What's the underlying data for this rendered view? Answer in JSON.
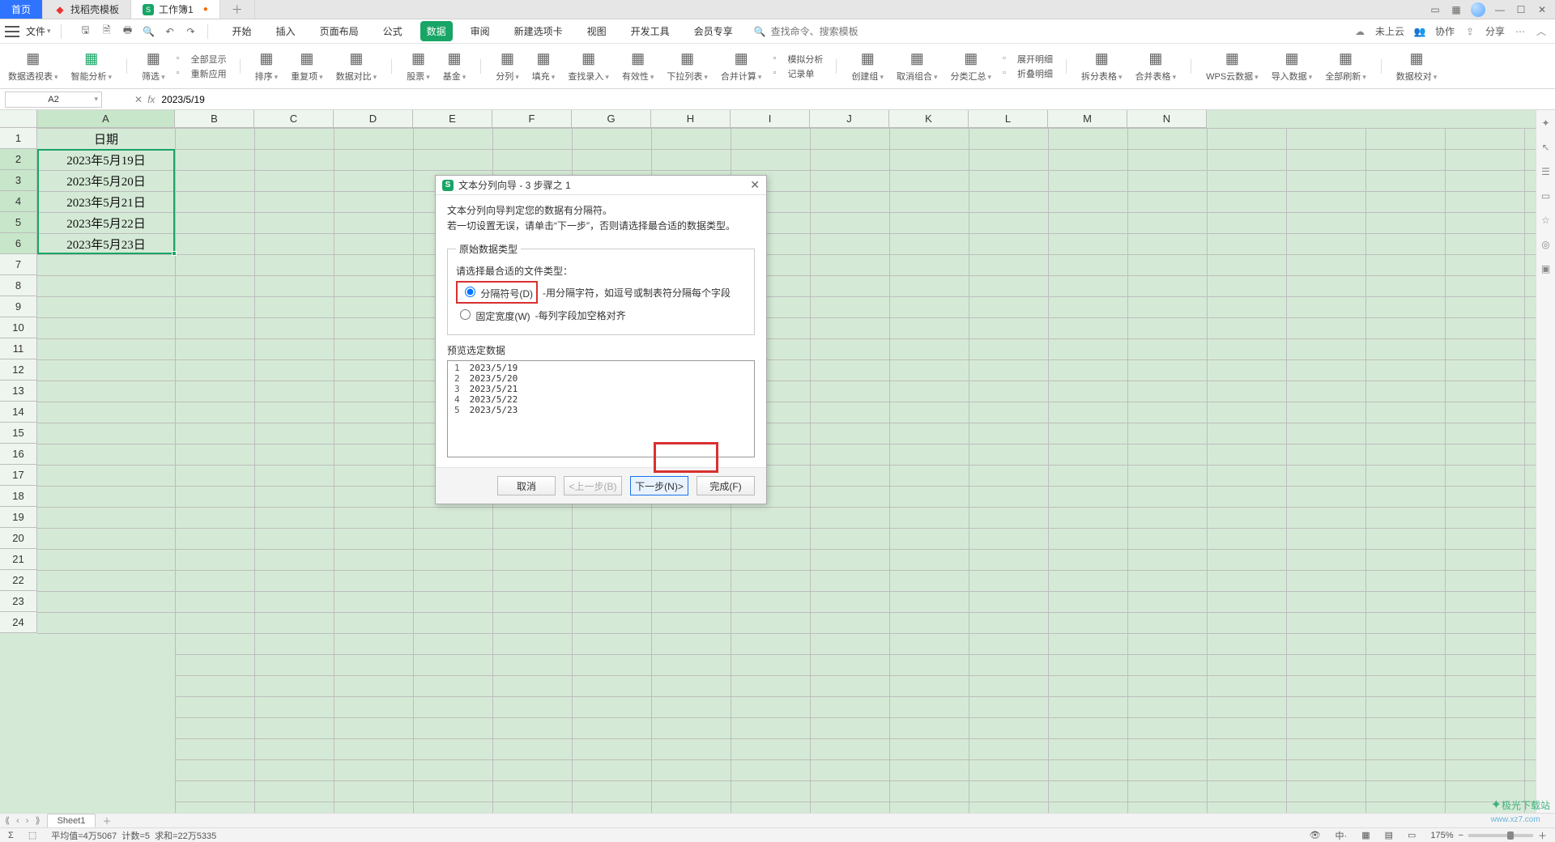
{
  "tabs": {
    "home": "首页",
    "template_title": "找稻壳模板",
    "workbook_title": "工作簿1"
  },
  "file_menu": "文件",
  "ribbon_tabs": [
    "开始",
    "插入",
    "页面布局",
    "公式",
    "数据",
    "审阅",
    "新建选项卡",
    "视图",
    "开发工具",
    "会员专享"
  ],
  "ribbon_active_index": 4,
  "search_placeholder": "查找命令、搜索模板",
  "right_menu": {
    "cloud": "未上云",
    "coop": "协作",
    "share": "分享"
  },
  "ribbon_cols": [
    {
      "label": "数据透视表"
    },
    {
      "label": "智能分析",
      "green": true
    },
    {
      "label": "筛选"
    },
    {
      "labels": [
        "全部显示",
        "重新应用"
      ]
    },
    {
      "label": "排序"
    },
    {
      "label": "重复项"
    },
    {
      "label": "数据对比"
    },
    {
      "label": "股票"
    },
    {
      "label": "基金"
    },
    {
      "label": "分列"
    },
    {
      "label": "填充"
    },
    {
      "label": "查找录入"
    },
    {
      "label": "有效性"
    },
    {
      "label": "下拉列表"
    },
    {
      "label": "合并计算"
    },
    {
      "labels": [
        "模拟分析",
        "记录单"
      ]
    },
    {
      "label": "创建组"
    },
    {
      "label": "取消组合"
    },
    {
      "label": "分类汇总"
    },
    {
      "labels": [
        "展开明细",
        "折叠明细"
      ]
    },
    {
      "label": "拆分表格"
    },
    {
      "label": "合并表格"
    },
    {
      "label": "WPS云数据"
    },
    {
      "label": "导入数据"
    },
    {
      "label": "全部刷新"
    },
    {
      "label": "数据校对"
    }
  ],
  "namebox": "A2",
  "formula_value": "2023/5/19",
  "columns": [
    "A",
    "B",
    "C",
    "D",
    "E",
    "F",
    "G",
    "H",
    "I",
    "J",
    "K",
    "L",
    "M",
    "N"
  ],
  "rows_shown": 24,
  "sheet_data": {
    "A1": "日期",
    "A2": "2023年5月19日",
    "A3": "2023年5月20日",
    "A4": "2023年5月21日",
    "A5": "2023年5月22日",
    "A6": "2023年5月23日"
  },
  "selection": {
    "col": "A",
    "row_start": 2,
    "row_end": 6
  },
  "sheet_tab": "Sheet1",
  "status": {
    "avg_label": "平均值=",
    "avg": "4万5067",
    "count_label": "计数=",
    "count": "5",
    "sum_label": "求和=",
    "sum": "22万5335",
    "zoom": "175%"
  },
  "dialog": {
    "title": "文本分列向导 - 3 步骤之 1",
    "desc1": "文本分列向导判定您的数据有分隔符。",
    "desc2": "若一切设置无误，请单击“下一步”，否则请选择最合适的数据类型。",
    "fieldset_type": "原始数据类型",
    "type_hint": "请选择最合适的文件类型：",
    "opt_delim": "分隔符号(D)",
    "opt_delim_desc": "-用分隔字符，如逗号或制表符分隔每个字段",
    "opt_fixed": "固定宽度(W)",
    "opt_fixed_desc": "-每列字段加空格对齐",
    "preview_legend": "预览选定数据",
    "preview_rows": [
      {
        "n": "1",
        "v": "2023/5/19"
      },
      {
        "n": "2",
        "v": "2023/5/20"
      },
      {
        "n": "3",
        "v": "2023/5/21"
      },
      {
        "n": "4",
        "v": "2023/5/22"
      },
      {
        "n": "5",
        "v": "2023/5/23"
      }
    ],
    "btn_cancel": "取消",
    "btn_back": "<上一步(B)",
    "btn_next": "下一步(N)>",
    "btn_finish": "完成(F)"
  },
  "watermark": "极光下载站",
  "watermark_url": "www.xz7.com"
}
